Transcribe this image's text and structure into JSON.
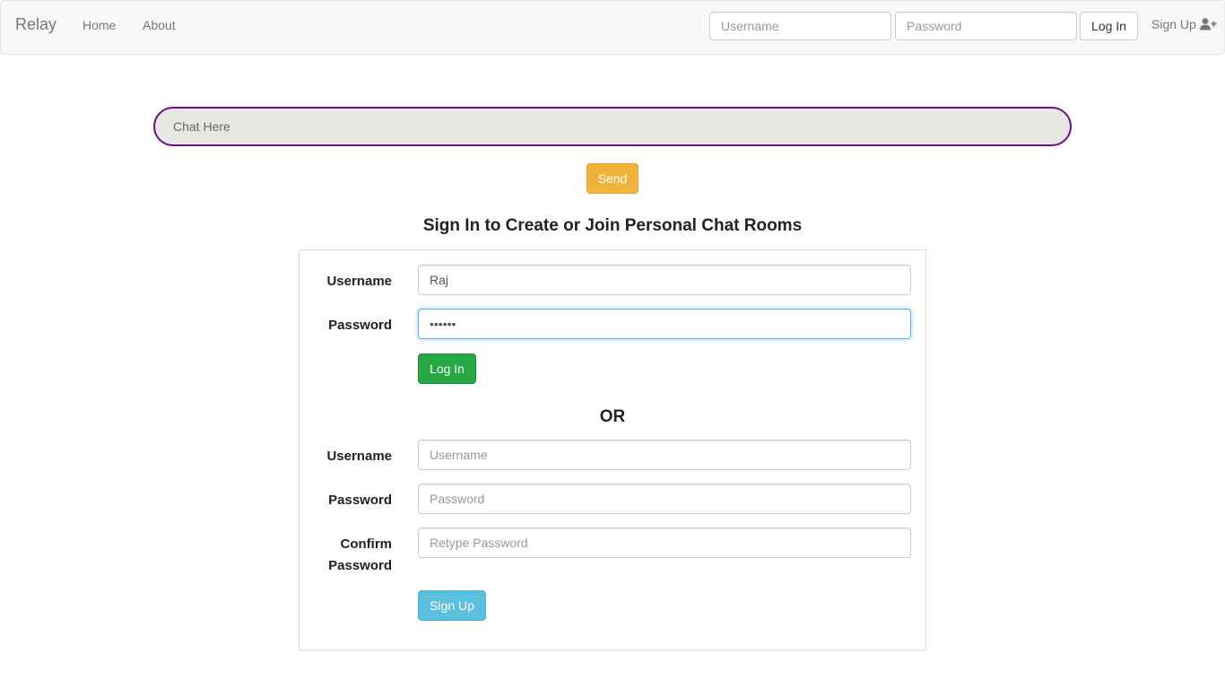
{
  "navbar": {
    "brand": "Relay",
    "links": [
      "Home",
      "About"
    ],
    "username_placeholder": "Username",
    "password_placeholder": "Password",
    "login_label": "Log In",
    "signup_label": "Sign Up",
    "signup_icon": "user-plus-icon"
  },
  "chat": {
    "placeholder": "Chat Here",
    "send_label": "Send"
  },
  "heading": "Sign In to Create or Join Personal Chat Rooms",
  "login_form": {
    "username_label": "Username",
    "username_value": "Raj",
    "password_label": "Password",
    "password_value": "••••••",
    "submit_label": "Log In"
  },
  "or_label": "OR",
  "signup_form": {
    "username_label": "Username",
    "username_placeholder": "Username",
    "password_label": "Password",
    "password_placeholder": "Password",
    "confirm_label_line1": "Confirm",
    "confirm_label_line2": "Password",
    "confirm_placeholder": "Retype Password",
    "submit_label": "Sign Up"
  },
  "colors": {
    "chat_border": "#6a0f8e",
    "send": "#f0b43c",
    "login": "#28a745",
    "signup": "#5bc0de"
  }
}
